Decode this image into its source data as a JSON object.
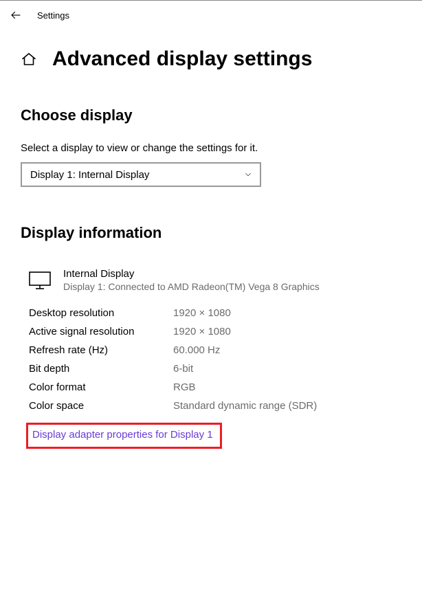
{
  "topbar": {
    "title": "Settings"
  },
  "page": {
    "title": "Advanced display settings"
  },
  "choose": {
    "heading": "Choose display",
    "helper": "Select a display to view or change the settings for it.",
    "dropdown_value": "Display 1: Internal Display"
  },
  "info": {
    "heading": "Display information",
    "display_name": "Internal Display",
    "display_sub": "Display 1: Connected to AMD Radeon(TM) Vega 8 Graphics",
    "rows": [
      {
        "label": "Desktop resolution",
        "value": "1920 × 1080"
      },
      {
        "label": "Active signal resolution",
        "value": "1920 × 1080"
      },
      {
        "label": "Refresh rate (Hz)",
        "value": "60.000 Hz"
      },
      {
        "label": "Bit depth",
        "value": "6-bit"
      },
      {
        "label": "Color format",
        "value": "RGB"
      },
      {
        "label": "Color space",
        "value": "Standard dynamic range (SDR)"
      }
    ],
    "link": "Display adapter properties for Display 1"
  },
  "highlight_color": "#ed1c24"
}
